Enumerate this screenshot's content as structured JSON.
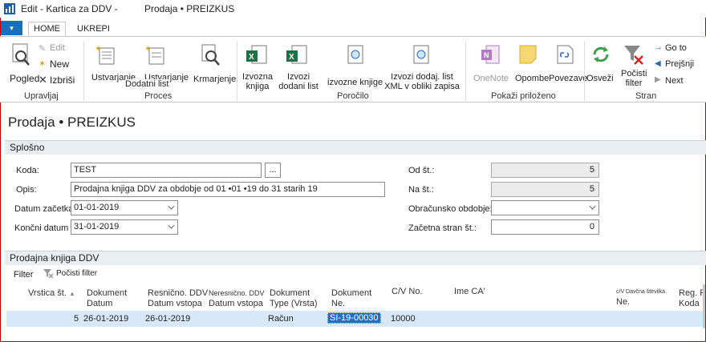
{
  "window": {
    "title_left": "Edit - Kartica za DDV -",
    "title_right": "Prodaja • PREIZKUS"
  },
  "ribbon": {
    "tabs": [
      "HOME",
      "UKREPI"
    ],
    "file_glyph": "▾",
    "groups": {
      "upravljaj": "Upravljaj",
      "proces": "Proces",
      "porocilo": "Poročilo",
      "pokazi": "Pokaži priloženo",
      "stran": "Stran"
    },
    "buttons": {
      "pogled": "Pogled",
      "edit": "Edit",
      "new": "New",
      "izbrisi": "Izbriši",
      "ustvarjanje1": "Ustvarjanje",
      "ustvarjanje2": "Ustvarjanje",
      "dodatni_list": "Dodatni list",
      "krmarjenje": "Krmarjenje",
      "izvozna_knjiga": "Izvozna knjiga",
      "izvozi_dodani_list": "Izvozi dodani list",
      "izvozne_knjige": "izvozne knjige",
      "izvozi_xml": "Izvozi dodaj. list XML v obliki zapisa",
      "onenote": "OneNote",
      "opombe": "Opombe",
      "povezave": "Povezave",
      "osvezi": "Osveži",
      "pocisti_filter": "Počisti filter",
      "goto": "Go to",
      "prejsnji": "Prejšnji",
      "next": "Next"
    },
    "icons": {
      "pogled": "view-icon",
      "edit": "edit-icon",
      "new": "new-icon",
      "izbrisi": "delete-icon",
      "onenote": "onenote-icon",
      "opombe": "note-icon",
      "povezave": "link-icon",
      "osvezi": "refresh-icon",
      "pocisti": "clear-filter-icon"
    }
  },
  "page": {
    "title": "Prodaja • PREIZKUS"
  },
  "splosno": {
    "header": "Splošno",
    "koda_label": "Koda:",
    "koda_value": "TEST",
    "lookup_button": "...",
    "opis_label": "Opis:",
    "opis_value": "Prodajna knjiga DDV za obdobje od 01 •01 •19 do 31 starih 19",
    "datum_zacetka_label": "Datum začetka",
    "datum_zacetka_value": "01-01-2019",
    "koncni_datum_label": "Končni datum",
    "koncni_datum_value": "31-01-2019",
    "od_st_label": "Od št.:",
    "od_st_value": "5",
    "na_st_label": "Na št.:",
    "na_st_value": "5",
    "obracunsko_label": "Obračunsko obdobje:",
    "obracunsko_value": "",
    "zacetna_stran_label": "Začetna stran št.:",
    "zacetna_stran_value": "0"
  },
  "knjiga": {
    "header": "Prodajna knjiga DDV",
    "filter_label": "Filter",
    "pocisti_filter": "Počisti filter",
    "columns": {
      "vrstica": "Vrstica št.",
      "dok_datum_1": "Dokument",
      "dok_datum_2": "Datum",
      "resnicno_1": "Resnično. DDV",
      "resnicno_2": "Datum vstopa",
      "neresnicno_1": "Neresnično. DDV",
      "neresnicno_2": "Datum vstopa",
      "dok_type_1": "Dokument",
      "dok_type_2": "Type (Vrsta)",
      "dok_ne_1": "Dokument",
      "dok_ne_2": "Ne.",
      "cv_no": "C/V No.",
      "ime_ca": "Ime CA'",
      "cv_davcna_1": "c/V Davčna številka.",
      "cv_davcna_2": "Ne.",
      "reg_1": "Reg. Rt",
      "reg_2": "Koda"
    },
    "rows": [
      {
        "vrstica": "5",
        "dok_datum": "26-01-2019",
        "resnicno_datum": "26-01-2019",
        "neresnicno_datum": "",
        "type": "Račun",
        "dok_ne": "SI-19-00030",
        "cv_no": "10000"
      }
    ]
  }
}
